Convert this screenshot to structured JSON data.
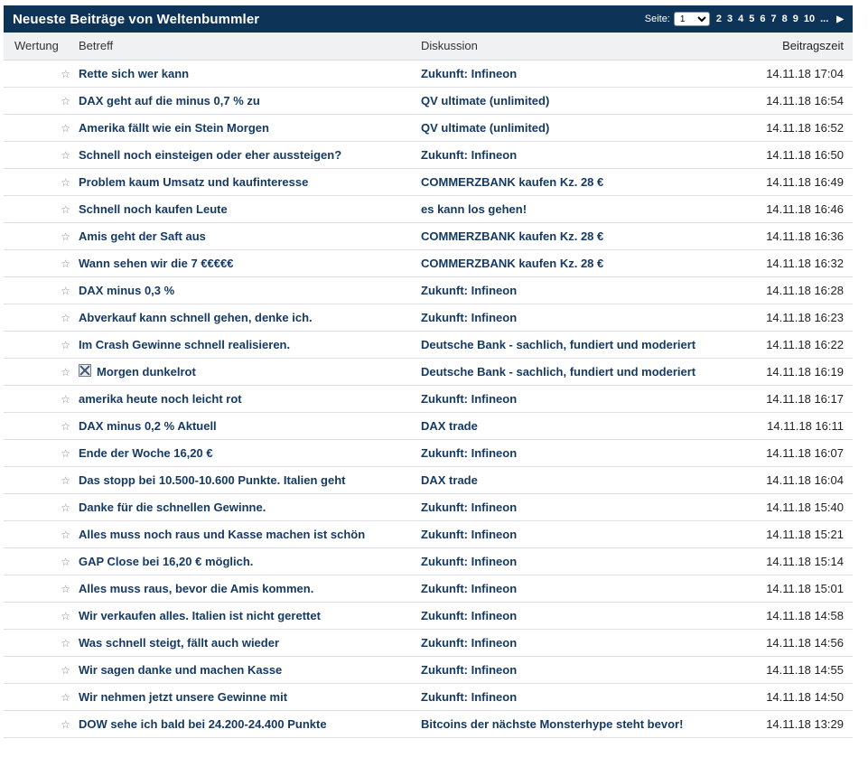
{
  "header": {
    "title": "Neueste Beiträge von Weltenbummler",
    "page_label": "Seite:",
    "selected_page": "1",
    "pages": [
      "2",
      "3",
      "4",
      "5",
      "6",
      "7",
      "8",
      "9",
      "10"
    ],
    "ellipsis": "...",
    "next_icon": "triangle-right-icon"
  },
  "columns": {
    "rating": "Wertung",
    "subject": "Betreff",
    "discussion": "Diskussion",
    "time": "Beitragszeit"
  },
  "rows": [
    {
      "subject": "Rette sich wer kann",
      "discussion": "Zukunft: Infineon",
      "time": "14.11.18 17:04"
    },
    {
      "subject": "DAX geht auf die minus 0,7 % zu",
      "discussion": "QV ultimate (unlimited)",
      "time": "14.11.18 16:54"
    },
    {
      "subject": "Amerika fällt wie ein Stein Morgen",
      "discussion": "QV ultimate (unlimited)",
      "time": "14.11.18 16:52"
    },
    {
      "subject": "Schnell noch einsteigen oder eher aussteigen?",
      "discussion": "Zukunft: Infineon",
      "time": "14.11.18 16:50"
    },
    {
      "subject": "Problem kaum Umsatz und kaufinteresse",
      "discussion": "COMMERZBANK kaufen Kz. 28 €",
      "time": "14.11.18 16:49"
    },
    {
      "subject": "Schnell noch kaufen Leute",
      "discussion": "es kann los gehen!",
      "time": "14.11.18 16:46"
    },
    {
      "subject": "Amis geht der Saft aus",
      "discussion": "COMMERZBANK kaufen Kz. 28 €",
      "time": "14.11.18 16:36"
    },
    {
      "subject": "Wann sehen wir die 7 €€€€€",
      "discussion": "COMMERZBANK kaufen Kz. 28 €",
      "time": "14.11.18 16:32"
    },
    {
      "subject": "DAX minus 0,3 %",
      "discussion": "Zukunft: Infineon",
      "time": "14.11.18 16:28"
    },
    {
      "subject": "Abverkauf kann schnell gehen, denke ich.",
      "discussion": "Zukunft: Infineon",
      "time": "14.11.18 16:23"
    },
    {
      "subject": "Im Crash Gewinne schnell realisieren.",
      "discussion": "Deutsche Bank - sachlich, fundiert und moderiert",
      "time": "14.11.18 16:22"
    },
    {
      "subject": "Morgen dunkelrot",
      "discussion": "Deutsche Bank - sachlich, fundiert und moderiert",
      "time": "14.11.18 16:19",
      "has_image": true
    },
    {
      "subject": "amerika heute noch leicht rot",
      "discussion": "Zukunft: Infineon",
      "time": "14.11.18 16:17"
    },
    {
      "subject": "DAX minus 0,2 % Aktuell",
      "discussion": "DAX trade",
      "time": "14.11.18 16:11"
    },
    {
      "subject": "Ende der Woche 16,20 €",
      "discussion": "Zukunft: Infineon",
      "time": "14.11.18 16:07"
    },
    {
      "subject": "Das stopp bei 10.500-10.600 Punkte. Italien geht",
      "discussion": "DAX trade",
      "time": "14.11.18 16:04"
    },
    {
      "subject": "Danke für die schnellen Gewinne.",
      "discussion": "Zukunft: Infineon",
      "time": "14.11.18 15:40"
    },
    {
      "subject": "Alles muss noch raus und Kasse machen ist schön",
      "discussion": "Zukunft: Infineon",
      "time": "14.11.18 15:21"
    },
    {
      "subject": "GAP Close bei 16,20 € möglich.",
      "discussion": "Zukunft: Infineon",
      "time": "14.11.18 15:14"
    },
    {
      "subject": "Alles muss raus, bevor die Amis kommen.",
      "discussion": "Zukunft: Infineon",
      "time": "14.11.18 15:01"
    },
    {
      "subject": "Wir verkaufen alles. Italien ist nicht gerettet",
      "discussion": "Zukunft: Infineon",
      "time": "14.11.18 14:58"
    },
    {
      "subject": "Was schnell steigt, fällt auch wieder",
      "discussion": "Zukunft: Infineon",
      "time": "14.11.18 14:56"
    },
    {
      "subject": "Wir sagen danke und machen Kasse",
      "discussion": "Zukunft: Infineon",
      "time": "14.11.18 14:55"
    },
    {
      "subject": "Wir nehmen jetzt unsere Gewinne mit",
      "discussion": "Zukunft: Infineon",
      "time": "14.11.18 14:50"
    },
    {
      "subject": "DOW sehe ich bald bei 24.200-24.400 Punkte",
      "discussion": "Bitcoins der nächste Monsterhype steht bevor!",
      "time": "14.11.18 13:29"
    }
  ],
  "colors": {
    "header_bg": "#0d3357",
    "link": "#153a64",
    "row_border": "#dcdfe3"
  }
}
